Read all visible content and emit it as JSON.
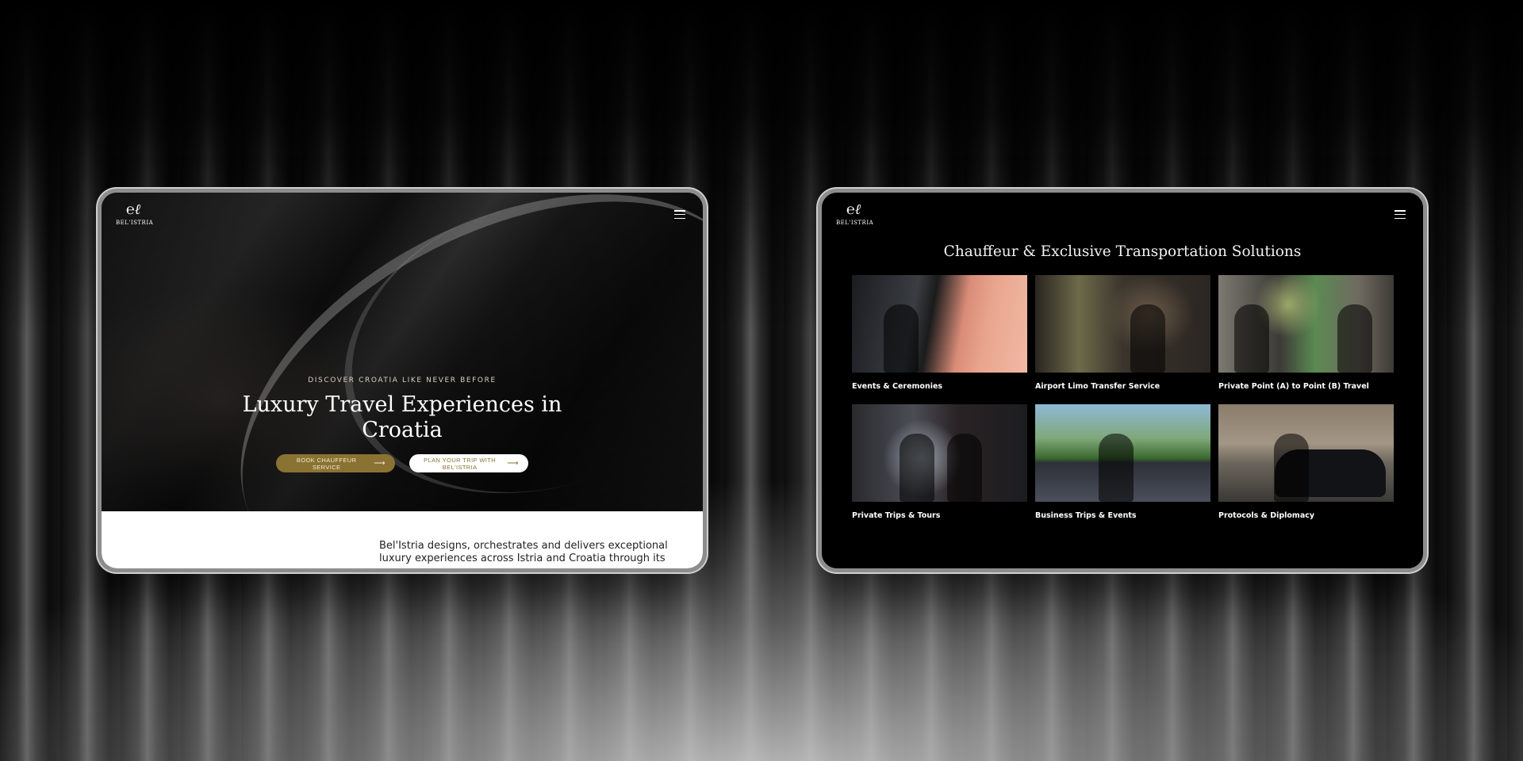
{
  "brand": {
    "logo_mark": "℮ℓ",
    "logo_word": "BEL'ISTRIA"
  },
  "left_screen": {
    "hero": {
      "eyebrow": "DISCOVER CROATIA LIKE NEVER BEFORE",
      "title": "Luxury Travel Experiences in Croatia",
      "cta_primary": "BOOK CHAUFFEUR SERVICE",
      "cta_secondary": "PLAN YOUR TRIP WITH BEL'ISTRIA",
      "arrow": "⟶"
    },
    "intro_text": "Bel'Istria designs, orchestrates and delivers exceptional luxury experiences across Istria and Croatia through its"
  },
  "right_screen": {
    "section_title": "Chauffeur & Exclusive Transportation Solutions",
    "services": [
      {
        "label": "Events & Ceremonies"
      },
      {
        "label": "Airport Limo Transfer Service"
      },
      {
        "label": "Private Point (A) to Point (B) Travel"
      },
      {
        "label": "Private Trips & Tours"
      },
      {
        "label": "Business Trips & Events"
      },
      {
        "label": "Protocols & Diplomacy"
      }
    ]
  },
  "colors": {
    "gold": "#8a7232",
    "dark_bg": "#000000",
    "light_bg": "#ffffff"
  },
  "icons": {
    "menu": "hamburger-menu-icon",
    "arrow": "arrow-right-icon"
  }
}
